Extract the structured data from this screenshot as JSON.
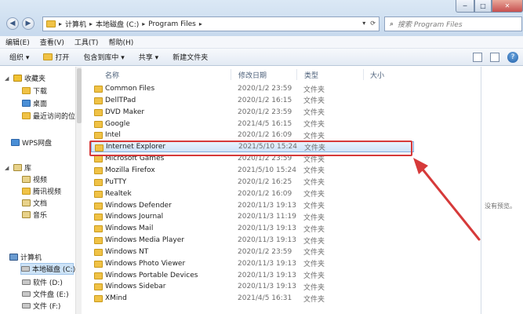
{
  "window": {
    "controls": [
      "─",
      "□",
      "✕"
    ]
  },
  "address": {
    "crumbs": [
      "计算机",
      "本地磁盘 (C:)",
      "Program Files"
    ]
  },
  "search": {
    "placeholder": "搜索 Program Files"
  },
  "menubar": [
    "编辑(E)",
    "查看(V)",
    "工具(T)",
    "帮助(H)"
  ],
  "toolbar": {
    "organize": "组织 ▾",
    "open": "打开",
    "include": "包含到库中 ▾",
    "share": "共享 ▾",
    "new_folder": "新建文件夹",
    "help": "?"
  },
  "sidebar": {
    "favorites": "收藏夹",
    "downloads": "下载",
    "desktop": "桌面",
    "recent": "最近访问的位",
    "wps": "WPS网盘",
    "library": "库",
    "videos": "视频",
    "tencent_video": "腾讯视频",
    "documents": "文档",
    "music": "音乐",
    "computer": "计算机",
    "drive_c": "本地磁盘 (C:)",
    "drive_d": "软件 (D:)",
    "drive_e": "文件盘 (E:)",
    "drive_f": "文件 (F:)"
  },
  "columns": {
    "name": "名称",
    "date": "修改日期",
    "type": "类型",
    "size": "大小"
  },
  "files": [
    {
      "name": "Common Files",
      "date": "2020/1/2 23:59",
      "type": "文件夹"
    },
    {
      "name": "DellTPad",
      "date": "2020/1/2 16:15",
      "type": "文件夹"
    },
    {
      "name": "DVD Maker",
      "date": "2020/1/2 23:59",
      "type": "文件夹"
    },
    {
      "name": "Google",
      "date": "2021/4/5 16:15",
      "type": "文件夹"
    },
    {
      "name": "Intel",
      "date": "2020/1/2 16:09",
      "type": "文件夹"
    },
    {
      "name": "Internet Explorer",
      "date": "2021/5/10 15:24",
      "type": "文件夹"
    },
    {
      "name": "Microsoft Games",
      "date": "2020/1/2 23:59",
      "type": "文件夹"
    },
    {
      "name": "Mozilla Firefox",
      "date": "2021/5/10 15:24",
      "type": "文件夹"
    },
    {
      "name": "PuTTY",
      "date": "2020/1/2 16:25",
      "type": "文件夹"
    },
    {
      "name": "Realtek",
      "date": "2020/1/2 16:09",
      "type": "文件夹"
    },
    {
      "name": "Windows Defender",
      "date": "2020/11/3 19:13",
      "type": "文件夹"
    },
    {
      "name": "Windows Journal",
      "date": "2020/11/3 11:19",
      "type": "文件夹"
    },
    {
      "name": "Windows Mail",
      "date": "2020/11/3 19:13",
      "type": "文件夹"
    },
    {
      "name": "Windows Media Player",
      "date": "2020/11/3 19:13",
      "type": "文件夹"
    },
    {
      "name": "Windows NT",
      "date": "2020/1/2 23:59",
      "type": "文件夹"
    },
    {
      "name": "Windows Photo Viewer",
      "date": "2020/11/3 19:13",
      "type": "文件夹"
    },
    {
      "name": "Windows Portable Devices",
      "date": "2020/11/3 19:13",
      "type": "文件夹"
    },
    {
      "name": "Windows Sidebar",
      "date": "2020/11/3 19:13",
      "type": "文件夹"
    },
    {
      "name": "XMind",
      "date": "2021/4/5 16:31",
      "type": "文件夹"
    }
  ],
  "selected_file": "Internet Explorer",
  "preview_text": "没有预览。",
  "accent_color": "#d63a3a"
}
